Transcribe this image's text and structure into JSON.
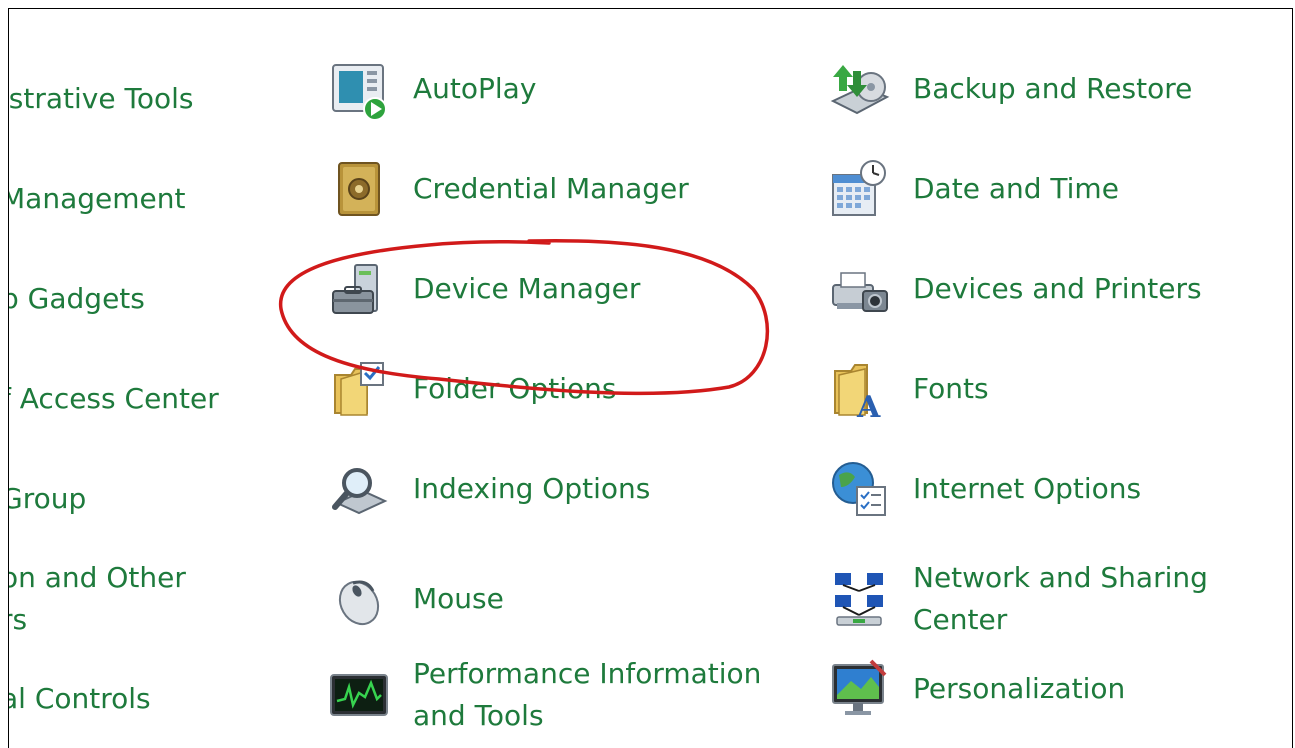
{
  "items": [
    {
      "label": "istrative Tools",
      "icon": "administrative-tools-icon"
    },
    {
      "label": "Management",
      "icon": "color-management-icon"
    },
    {
      "label": "p Gadgets",
      "icon": "desktop-gadgets-icon"
    },
    {
      "label": "f Access Center",
      "icon": "ease-of-access-icon"
    },
    {
      "label": "Group",
      "icon": "homegroup-icon"
    },
    {
      "label": "on and Other",
      "label2": "rs",
      "icon": "location-sensors-icon"
    },
    {
      "label": "al Controls",
      "icon": "parental-controls-icon"
    },
    {
      "label": "AutoPlay",
      "icon": "autoplay-icon"
    },
    {
      "label": "Credential Manager",
      "icon": "credential-manager-icon"
    },
    {
      "label": "Device Manager",
      "icon": "device-manager-icon"
    },
    {
      "label": "Folder Options",
      "icon": "folder-options-icon"
    },
    {
      "label": "Indexing Options",
      "icon": "indexing-options-icon"
    },
    {
      "label": "Mouse",
      "icon": "mouse-icon"
    },
    {
      "label": "Performance Information",
      "label2": "and Tools",
      "icon": "performance-icon"
    },
    {
      "label": "Backup and Restore",
      "icon": "backup-restore-icon"
    },
    {
      "label": "Date and Time",
      "icon": "date-time-icon"
    },
    {
      "label": "Devices and Printers",
      "icon": "devices-printers-icon"
    },
    {
      "label": "Fonts",
      "icon": "fonts-icon"
    },
    {
      "label": "Internet Options",
      "icon": "internet-options-icon"
    },
    {
      "label": "Network and Sharing",
      "label2": "Center",
      "icon": "network-sharing-icon"
    },
    {
      "label": "Personalization",
      "icon": "personalization-icon"
    }
  ],
  "colors": {
    "link": "#1e7a3c",
    "annotation": "#d11a1a"
  }
}
